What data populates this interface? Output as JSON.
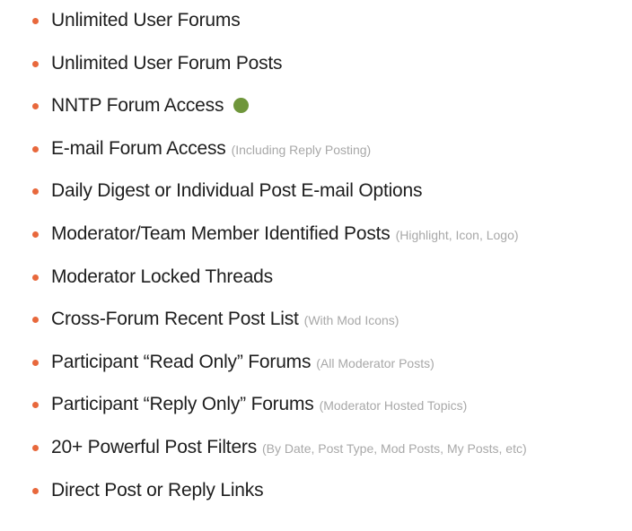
{
  "colors": {
    "bullet": "#e8683c",
    "label_text": "#1e1e1e",
    "note_text": "#a8a8a8",
    "status_dot": "#6f963b"
  },
  "features": [
    {
      "label": "Unlimited User Forums",
      "note": ""
    },
    {
      "label": "Unlimited User Forum Posts",
      "note": ""
    },
    {
      "label": "NNTP Forum Access",
      "note": "",
      "status_icon": "green-dot-icon"
    },
    {
      "label": "E-mail Forum Access",
      "note": "(Including Reply Posting)"
    },
    {
      "label": "Daily Digest or Individual Post E-mail Options",
      "note": ""
    },
    {
      "label": "Moderator/Team Member Identified Posts",
      "note": "(Highlight, Icon, Logo)"
    },
    {
      "label": "Moderator Locked Threads",
      "note": ""
    },
    {
      "label": "Cross-Forum Recent Post List",
      "note": "(With Mod Icons)"
    },
    {
      "label": "Participant “Read Only” Forums",
      "note": "(All Moderator Posts)"
    },
    {
      "label": "Participant “Reply Only” Forums",
      "note": "(Moderator Hosted Topics)"
    },
    {
      "label": "20+ Powerful Post Filters",
      "note": "(By Date, Post Type, Mod Posts, My Posts, etc)"
    },
    {
      "label": "Direct Post or Reply Links",
      "note": ""
    }
  ]
}
